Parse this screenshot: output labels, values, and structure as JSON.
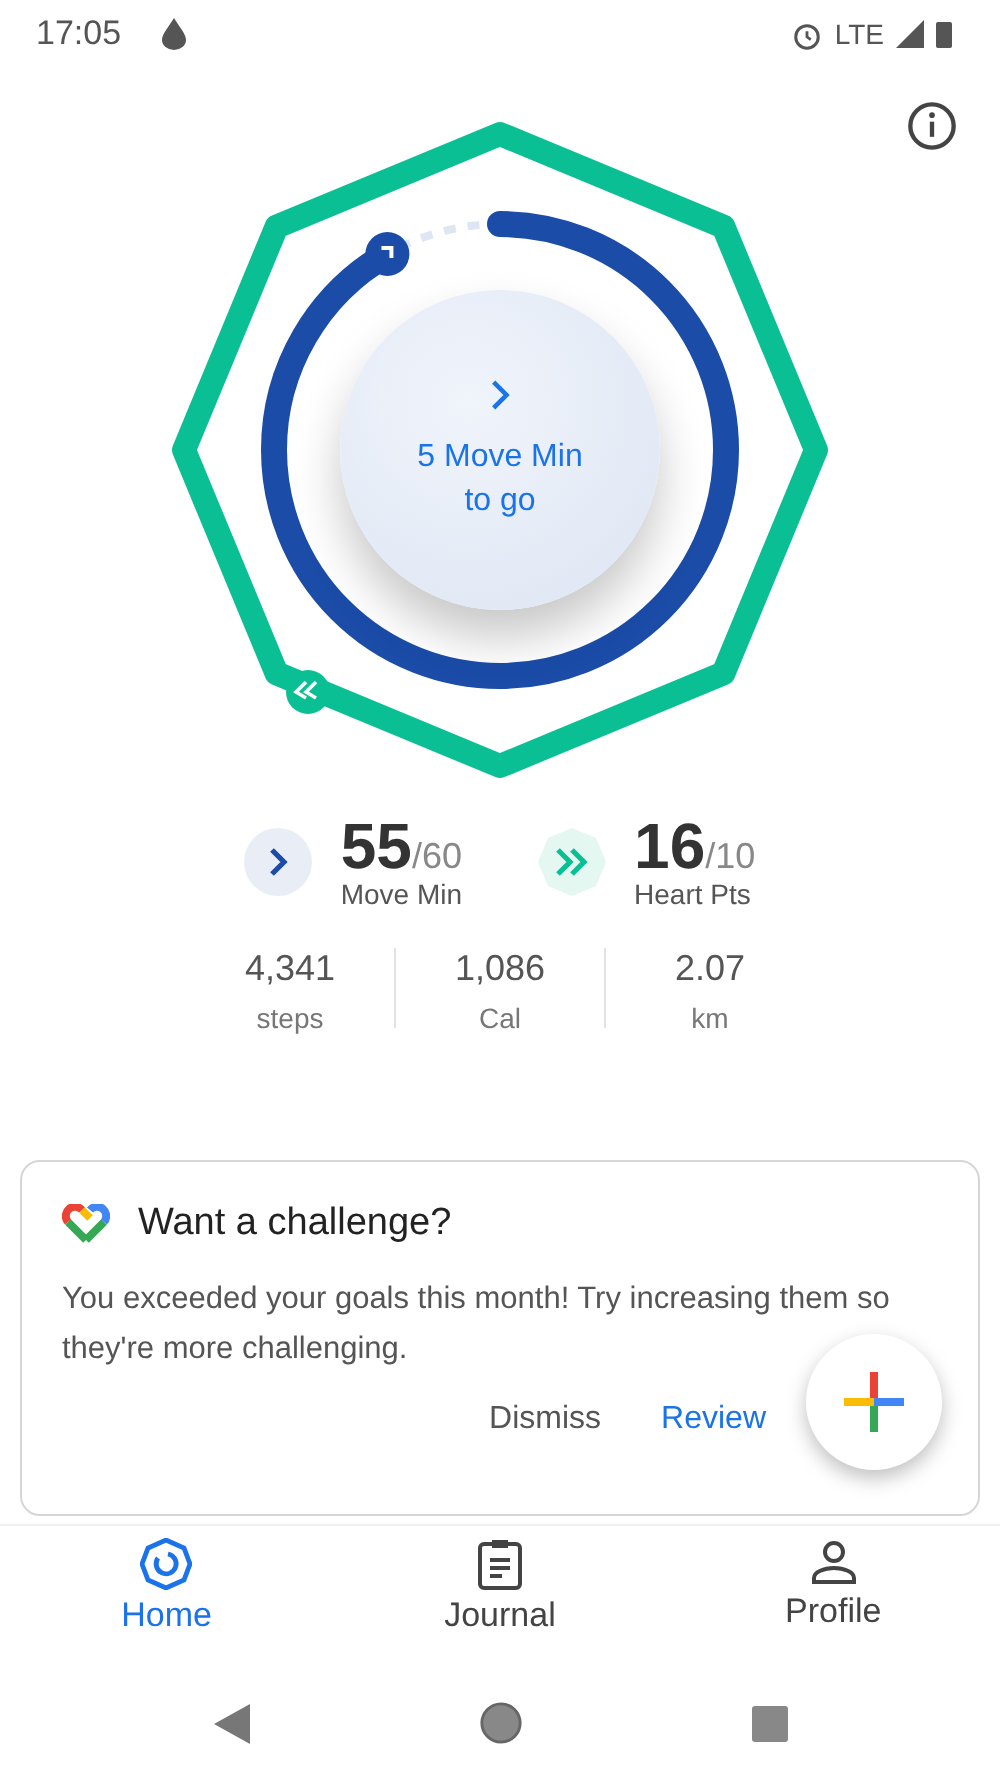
{
  "status_bar": {
    "time": "17:05",
    "network": "LTE"
  },
  "rings": {
    "move": {
      "level": 0.917
    },
    "center_text": "5 Move Min to go"
  },
  "goals": [
    {
      "kind": "move",
      "value": "55",
      "target": "/60",
      "label": "Move Min"
    },
    {
      "kind": "heart",
      "value": "16",
      "target": "/10",
      "label": "Heart Pts"
    }
  ],
  "stats": [
    {
      "value": "4,341",
      "unit": "steps"
    },
    {
      "value": "1,086",
      "unit": "Cal"
    },
    {
      "value": "2.07",
      "unit": "km"
    }
  ],
  "card": {
    "title": "Want a challenge?",
    "body": "You exceeded your goals this month! Try increasing them so they're more challenging.",
    "actions": [
      {
        "label": "Dismiss",
        "kind": "secondary"
      },
      {
        "label": "Review",
        "kind": "primary"
      }
    ]
  },
  "tabs": [
    {
      "label": "Home",
      "kind": "home",
      "selected": true
    },
    {
      "label": "Journal",
      "kind": "journal",
      "selected": false
    },
    {
      "label": "Profile",
      "kind": "profile",
      "selected": false
    }
  ]
}
